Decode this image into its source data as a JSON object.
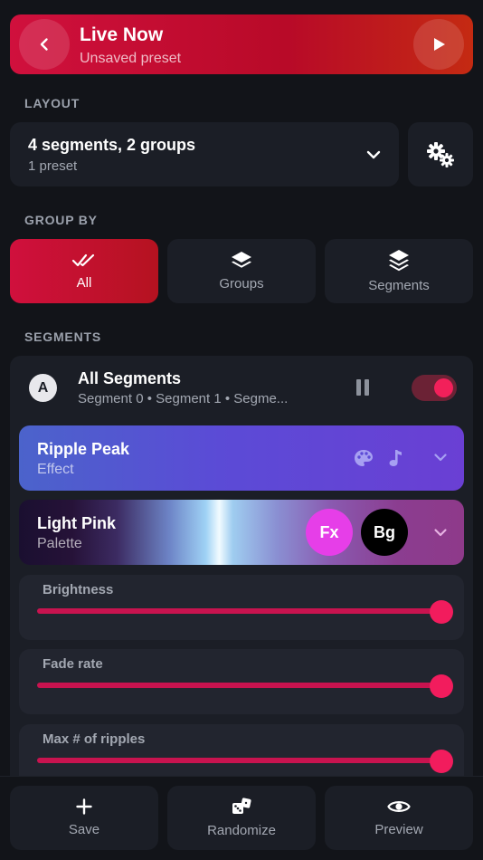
{
  "header": {
    "title": "Live Now",
    "subtitle": "Unsaved preset",
    "icons": {
      "back": "chevron-left-icon",
      "play": "play-icon"
    }
  },
  "layout": {
    "section_label": "LAYOUT",
    "title": "4 segments, 2 groups",
    "subtitle": "1 preset"
  },
  "group_by": {
    "section_label": "GROUP BY",
    "options": [
      {
        "label": "All",
        "icon": "double-check-icon",
        "selected": true
      },
      {
        "label": "Groups",
        "icon": "layers-icon",
        "selected": false
      },
      {
        "label": "Segments",
        "icon": "stacked-layers-icon",
        "selected": false
      }
    ]
  },
  "segments": {
    "section_label": "SEGMENTS",
    "avatar_letter": "A",
    "title": "All Segments",
    "subtitle": "Segment 0 • Segment 1 • Segme...",
    "toggle_on": true,
    "effect": {
      "title": "Ripple Peak",
      "subtitle": "Effect"
    },
    "palette": {
      "title": "Light Pink",
      "subtitle": "Palette",
      "fx_label": "Fx",
      "bg_label": "Bg"
    },
    "sliders": [
      {
        "label": "Brightness",
        "value": 1.0
      },
      {
        "label": "Fade rate",
        "value": 1.0
      },
      {
        "label": "Max # of ripples",
        "value": 1.0
      }
    ]
  },
  "bottom": {
    "save_label": "Save",
    "randomize_label": "Randomize",
    "preview_label": "Preview"
  },
  "colors": {
    "accent": "#d0103d",
    "slider": "#f21c5d",
    "fx_chip": "#e63ee8"
  }
}
